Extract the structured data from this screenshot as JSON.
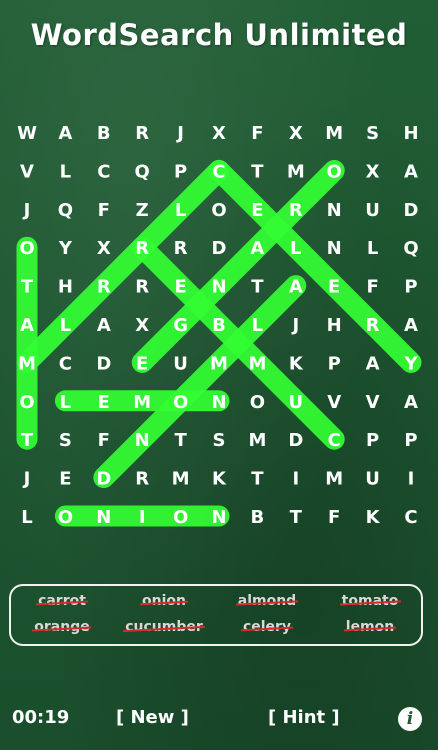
{
  "app": {
    "title": "WordSearch Unlimited"
  },
  "colors": {
    "highlight": "#33ff33",
    "strike": "#d62a2a",
    "board": "#1f5a32"
  },
  "grid": [
    [
      "W",
      "A",
      "B",
      "R",
      "J",
      "X",
      "F",
      "X",
      "M",
      "S",
      "H"
    ],
    [
      "V",
      "L",
      "C",
      "Q",
      "P",
      "C",
      "T",
      "M",
      "O",
      "X",
      "A"
    ],
    [
      "J",
      "Q",
      "F",
      "Z",
      "L",
      "O",
      "E",
      "R",
      "N",
      "U",
      "D"
    ],
    [
      "O",
      "Y",
      "X",
      "R",
      "R",
      "D",
      "A",
      "L",
      "N",
      "L",
      "Q"
    ],
    [
      "T",
      "H",
      "R",
      "R",
      "E",
      "N",
      "T",
      "A",
      "E",
      "F",
      "P"
    ],
    [
      "A",
      "L",
      "A",
      "X",
      "G",
      "B",
      "L",
      "J",
      "H",
      "R",
      "A"
    ],
    [
      "M",
      "C",
      "D",
      "E",
      "U",
      "M",
      "M",
      "K",
      "P",
      "A",
      "Y"
    ],
    [
      "O",
      "L",
      "E",
      "M",
      "O",
      "N",
      "O",
      "U",
      "V",
      "V",
      "A"
    ],
    [
      "T",
      "S",
      "F",
      "N",
      "T",
      "S",
      "M",
      "D",
      "C",
      "P",
      "P"
    ],
    [
      "J",
      "E",
      "D",
      "R",
      "M",
      "K",
      "T",
      "I",
      "M",
      "U",
      "I"
    ],
    [
      "L",
      "O",
      "N",
      "I",
      "O",
      "N",
      "B",
      "T",
      "F",
      "K",
      "C"
    ]
  ],
  "found_words": [
    {
      "word": "tomato",
      "start": [
        3,
        0
      ],
      "end": [
        8,
        0
      ]
    },
    {
      "word": "lemon",
      "start": [
        7,
        1
      ],
      "end": [
        7,
        5
      ]
    },
    {
      "word": "onion",
      "start": [
        10,
        1
      ],
      "end": [
        10,
        5
      ]
    },
    {
      "word": "cucumber",
      "start": [
        1,
        5
      ],
      "end": [
        6,
        0
      ]
    },
    {
      "word": "carrot",
      "start": [
        1,
        5
      ],
      "end": [
        6,
        10
      ]
    },
    {
      "word": "celery",
      "start": [
        1,
        8
      ],
      "end": [
        6,
        3
      ]
    },
    {
      "word": "orange",
      "start": [
        3,
        3
      ],
      "end": [
        8,
        8
      ]
    },
    {
      "word": "almond",
      "start": [
        4,
        7
      ],
      "end": [
        9,
        2
      ]
    }
  ],
  "word_list": {
    "row1": [
      "carrot",
      "onion",
      "almond",
      "tomato"
    ],
    "row2": [
      "orange",
      "cucumber",
      "celery",
      "lemon"
    ]
  },
  "footer": {
    "timer": "00:19",
    "new_label": "[ New ]",
    "hint_label": "[ Hint ]",
    "info_glyph": "i"
  }
}
